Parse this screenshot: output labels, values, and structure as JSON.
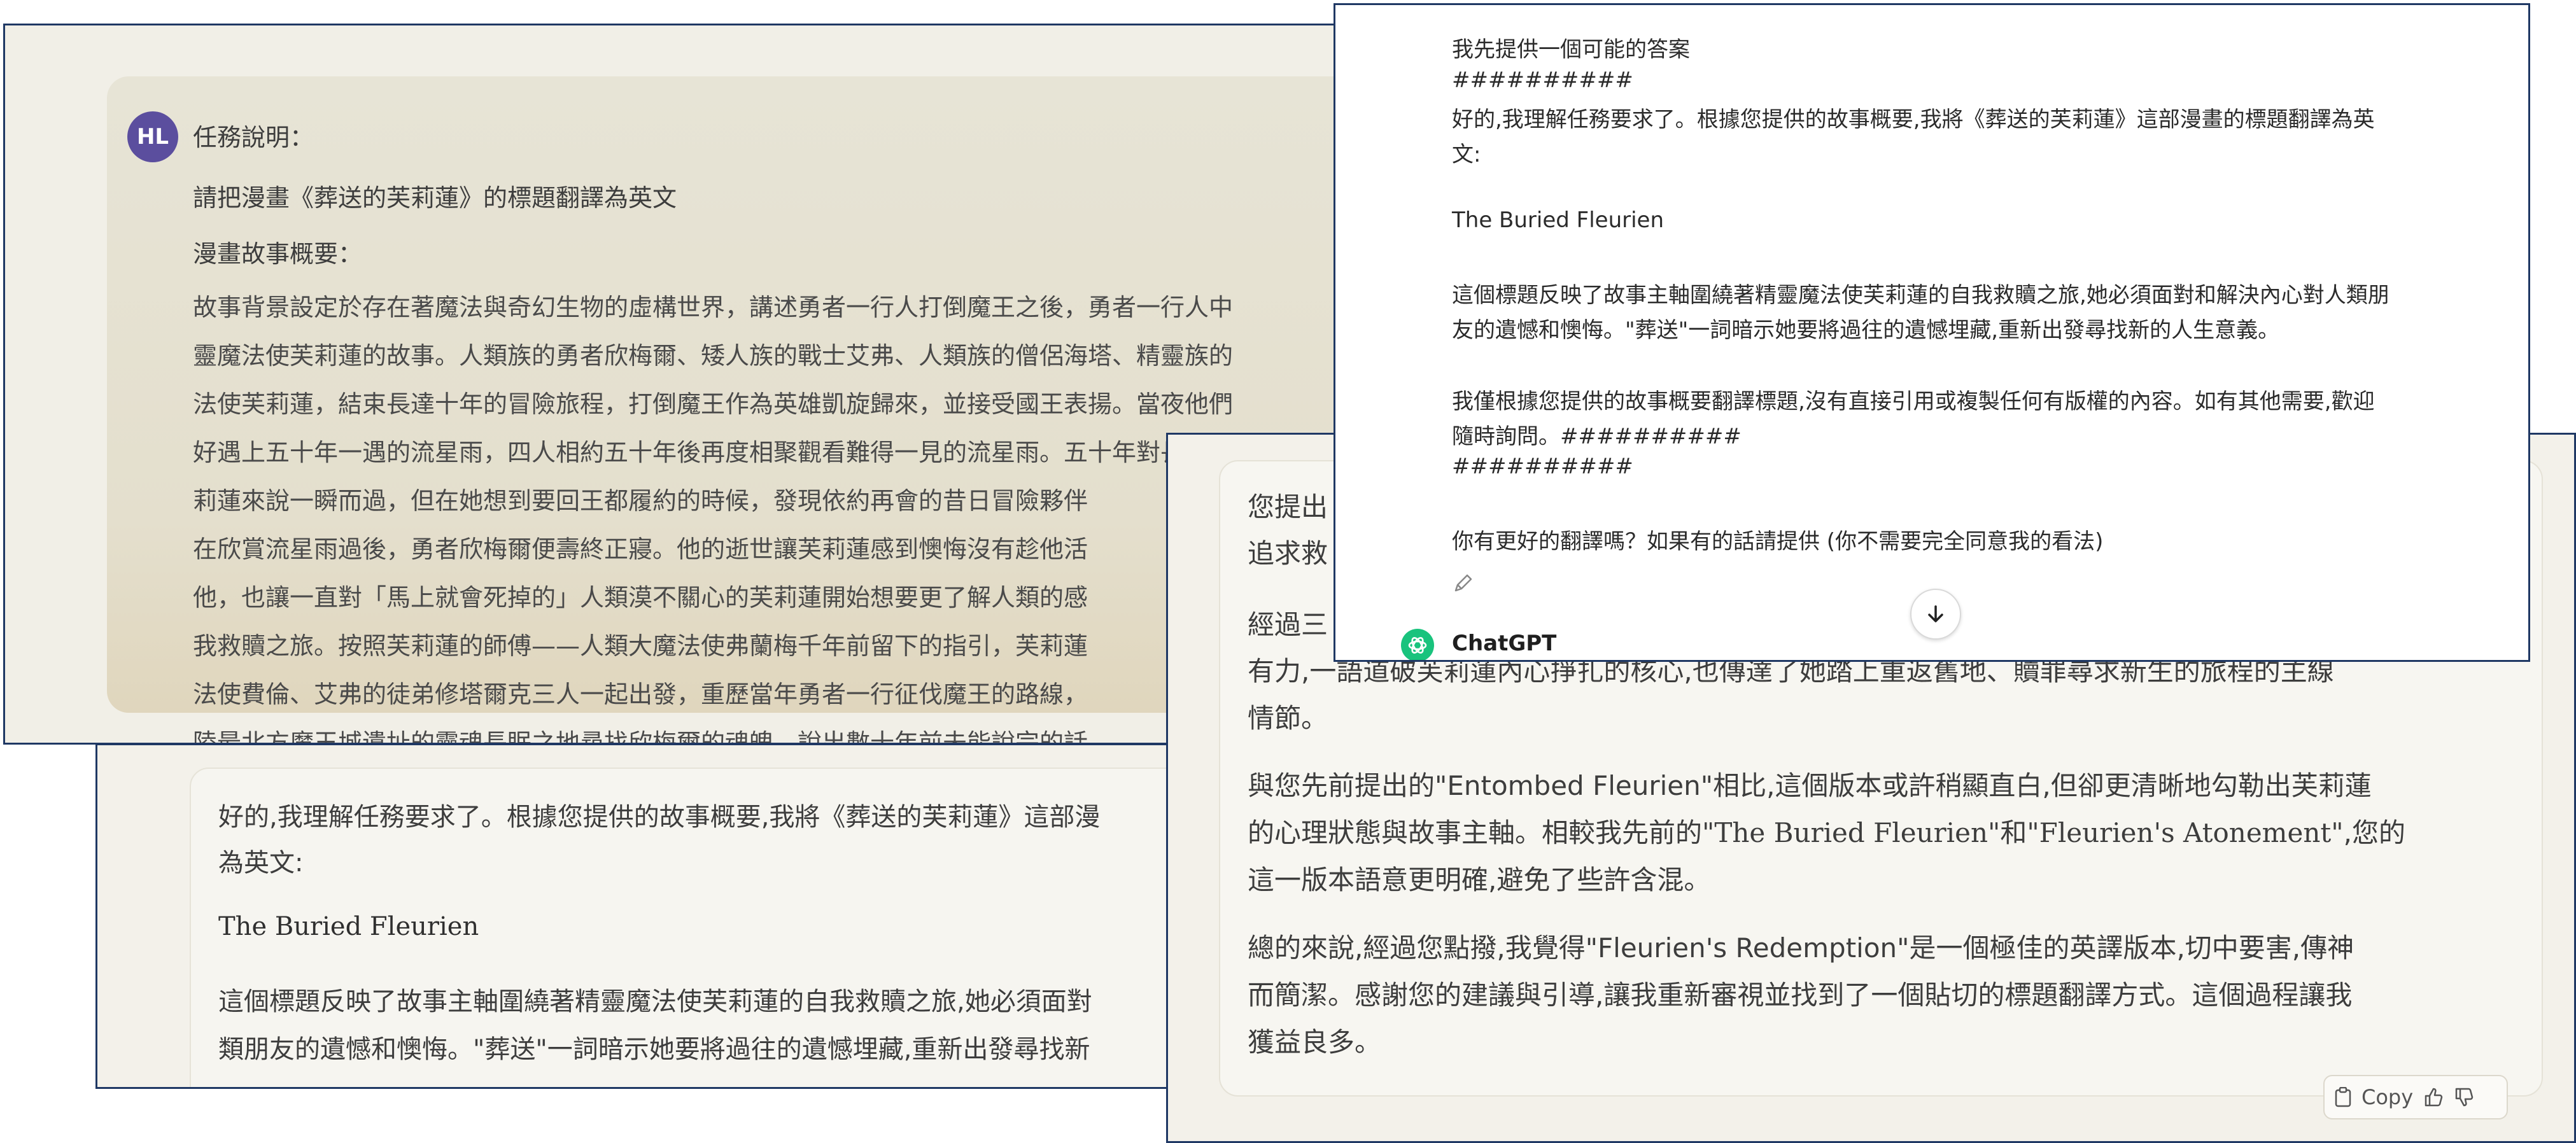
{
  "prompt": {
    "avatar_initials": "HL",
    "heading": "任務說明：",
    "instruction": "請把漫畫《葬送的芙莉蓮》的標題翻譯為英文",
    "summary_label": "漫畫故事概要：",
    "story_lines": [
      "故事背景設定於存在著魔法與奇幻生物的虛構世界，講述勇者一行人打倒魔王之後，勇者一行人中",
      "靈魔法使芙莉蓮的故事。人類族的勇者欣梅爾、矮人族的戰士艾弗、人類族的僧侶海塔、精靈族的",
      "法使芙莉蓮，結束長達十年的冒險旅程，打倒魔王作為英雄凱旋歸來，並接受國王表揚。當夜他們",
      "好遇上五十年一遇的流星雨，四人相約五十年後再度相聚觀看難得一見的流星雨。五十年對長壽的",
      "莉蓮來說一瞬而過，但在她想到要回王都履約的時候，發現依約再會的昔日冒險夥伴",
      "在欣賞流星雨過後，勇者欣梅爾便壽終正寢。他的逝世讓芙莉蓮感到懊悔沒有趁他活",
      "他，也讓一直對「馬上就會死掉的」人類漠不關心的芙莉蓮開始想要更了解人類的感",
      "我救贖之旅。按照芙莉蓮的師傅——人類大魔法使弗蘭梅千年前留下的指引，芙莉蓮",
      "法使費倫、艾弗的徒弟修塔爾克三人一起出發，重歷當年勇者一行征伐魔王的路線，",
      "陸最北方魔王城遺址的靈魂長眠之地尋找欣梅爾的魂魄，說出數十年前未能說完的話"
    ]
  },
  "answer": {
    "intro_line1": "好的,我理解任務要求了。根據您提供的故事概要,我將《葬送的芙莉蓮》這部漫",
    "intro_line2": "為英文:",
    "title": "The Buried Fleurien",
    "body_line1": "這個標題反映了故事主軸圍繞著精靈魔法使芙莉蓮的自我救贖之旅,她必須面對",
    "body_line2": "類朋友的遺憾和懊悔。\"葬送\"一詞暗示她要將過往的遺憾埋藏,重新出發尋找新"
  },
  "reply": {
    "line1": "您提出",
    "line2": "追求救",
    "line3": "經過三",
    "line4": "有力,一語道破芙莉蓮內心掙扎的核心,也傳達了她踏上重返舊地、贖罪尋求新生的旅程的主線",
    "line5": "情節。",
    "line6": "與您先前提出的\"Entombed Fleurien\"相比,這個版本或許稍顯直白,但卻更清晰地勾勒出芙莉蓮",
    "line7_pre": "的心理狀態與故事主軸。相較我先前的",
    "line7_q1": "\"The Buried Fleurien\"",
    "line7_mid": "和",
    "line7_q2": "\"Fleurien's Atonement\"",
    "line7_post": ",您的",
    "line8": "這一版本語意更明確,避免了些許含混。",
    "line9": "總的來說,經過您點撥,我覺得\"Fleurien's Redemption\"是一個極佳的英譯版本,切中要害,傳神",
    "line10": "而簡潔。感謝您的建議與引導,讓我重新審視並找到了一個貼切的標題翻譯方式。這個過程讓我",
    "line11": "獲益良多。",
    "copy_label": "Copy"
  },
  "chatgpt": {
    "l1": "我先提供一個可能的答案",
    "l2": "##########",
    "l3": "好的,我理解任務要求了。根據您提供的故事概要,我將《葬送的芙莉蓮》這部漫畫的標題翻譯為英",
    "l4": "文:",
    "l5": "The Buried Fleurien",
    "l6": "這個標題反映了故事主軸圍繞著精靈魔法使芙莉蓮的自我救贖之旅,她必須面對和解決內心對人類朋",
    "l7": "友的遺憾和懊悔。\"葬送\"一詞暗示她要將過往的遺憾埋藏,重新出發尋找新的人生意義。",
    "l8": "我僅根據您提供的故事概要翻譯標題,沒有直接引用或複製任何有版權的內容。如有其他需要,歡迎",
    "l9": "隨時詢問。##########",
    "l10": "##########",
    "l11": "你有更好的翻譯嗎？如果有的話請提供 (你不需要完全同意我的看法)",
    "name": "ChatGPT"
  },
  "colors": {
    "avatar": "#5b4e9e",
    "chatgpt_logo": "#19c37d",
    "frame_border": "#1f3864"
  }
}
